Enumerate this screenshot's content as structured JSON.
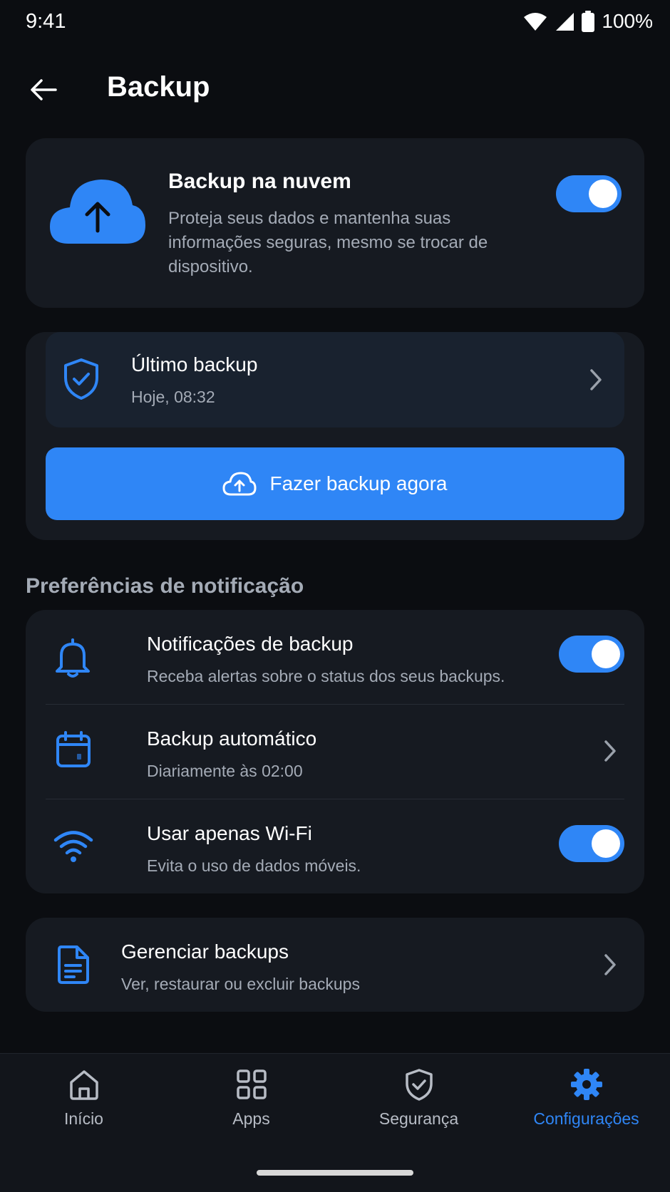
{
  "status_bar": {
    "time": "9:41",
    "battery": "100%"
  },
  "header": {
    "title": "Backup"
  },
  "cloud_backup": {
    "title": "Backup na nuvem",
    "description": "Proteja seus dados e mantenha suas informações seguras, mesmo se trocar de dispositivo.",
    "enabled": true
  },
  "last_backup": {
    "title": "Último backup",
    "value": "Hoje, 08:32"
  },
  "backup_now_button": {
    "label": "Fazer backup agora"
  },
  "notification_section": {
    "title": "Preferências de notificação",
    "items": [
      {
        "title": "Notificações de backup",
        "subtitle": "Receba alertas sobre o status dos seus backups.",
        "enabled": true
      },
      {
        "title": "Backup automático",
        "subtitle": "Diariamente às 02:00"
      },
      {
        "title": "Usar apenas Wi-Fi",
        "subtitle": "Evita o uso de dados móveis.",
        "enabled": true
      }
    ]
  },
  "manage_backups": {
    "title": "Gerenciar backups",
    "subtitle": "Ver, restaurar ou excluir backups"
  },
  "bottom_nav": {
    "items": [
      {
        "label": "Início",
        "icon": "home-icon"
      },
      {
        "label": "Apps",
        "icon": "grid-icon"
      },
      {
        "label": "Segurança",
        "icon": "shield-icon"
      },
      {
        "label": "Configurações",
        "icon": "gear-icon",
        "active": true
      }
    ]
  },
  "colors": {
    "accent": "#2f86f6",
    "background": "#0b0d11",
    "card": "#161a21",
    "muted_text": "#a4abb6"
  }
}
